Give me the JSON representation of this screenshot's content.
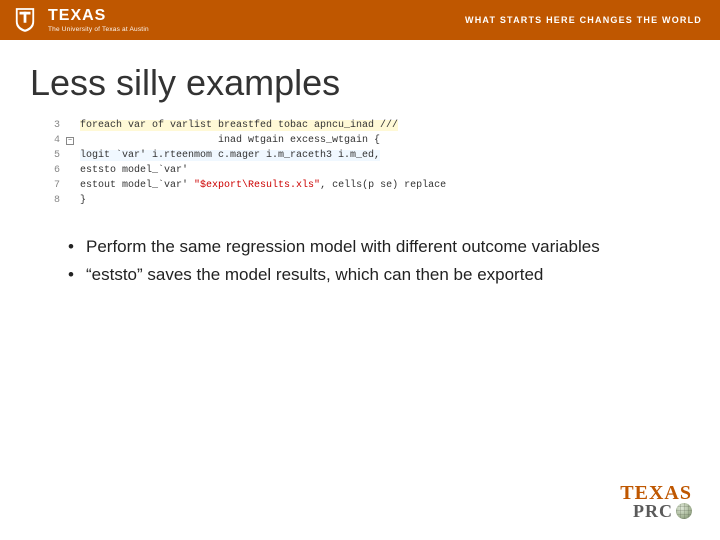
{
  "header": {
    "wordmark": "TEXAS",
    "subline": "The University of Texas at Austin",
    "tagline": "WHAT STARTS HERE CHANGES THE WORLD"
  },
  "title": "Less silly examples",
  "code": {
    "line_numbers": [
      "3",
      "4",
      "5",
      "6",
      "7",
      "8"
    ],
    "lines": {
      "l3": "foreach var of varlist breastfed tobac apncu_inad ///",
      "l4": "                       inad wtgain excess_wtgain {",
      "l5": "logit `var' i.rteenmom c.mager i.m_raceth3 i.m_ed,",
      "l6": "eststo model_`var'",
      "l7a": "estout model_`var' ",
      "l7b": "\"$export\\Results.xls\"",
      "l7c": ", cells(p se) replace",
      "l8": "}"
    }
  },
  "bullets": [
    "Perform the same regression model with different outcome variables",
    "“eststo” saves the model results, which can then be exported"
  ],
  "footer": {
    "line1": "TEXAS",
    "line2": "PRC"
  }
}
